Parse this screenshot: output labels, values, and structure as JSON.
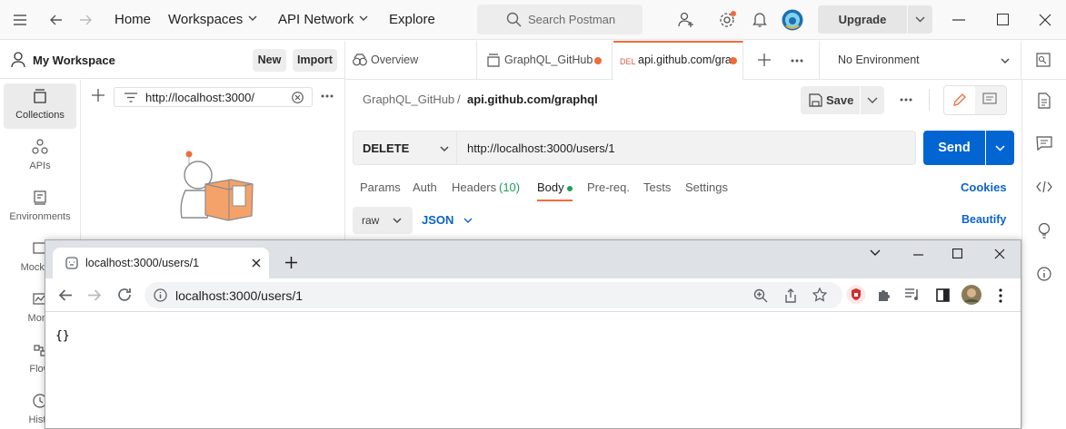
{
  "topbar": {
    "nav": [
      "Home",
      "Workspaces",
      "API Network",
      "Explore"
    ],
    "search_placeholder": "Search Postman",
    "upgrade_label": "Upgrade"
  },
  "sidebar": {
    "workspace_title": "My Workspace",
    "new_label": "New",
    "import_label": "Import",
    "filter_value": "http://localhost:3000/",
    "rail_items": [
      "Collections",
      "APIs",
      "Environments",
      "Mock Se",
      "Monit",
      "Flow",
      "Histo"
    ]
  },
  "tabs": {
    "overview": "Overview",
    "graphql": "GraphQL_GitHub",
    "del_method": "DEL",
    "del_url": "api.github.com/gra",
    "environment": "No Environment"
  },
  "request": {
    "breadcrumb_collection": "GraphQL_GitHub",
    "breadcrumb_sep": "/",
    "breadcrumb_request": "api.github.com/graphql",
    "save_label": "Save",
    "method": "DELETE",
    "url": "http://localhost:3000/users/1",
    "send_label": "Send",
    "tabs": {
      "params": "Params",
      "auth": "Auth",
      "headers": "Headers",
      "headers_count": "(10)",
      "body": "Body",
      "prereq": "Pre-req.",
      "tests": "Tests",
      "settings": "Settings"
    },
    "cookies_label": "Cookies",
    "body_mode": "raw",
    "body_format": "JSON",
    "beautify_label": "Beautify"
  },
  "browser": {
    "tab_title": "localhost:3000/users/1",
    "address": "localhost:3000/users/1",
    "content": "{}"
  },
  "colors": {
    "accent_orange": "#f26b3a",
    "send_blue": "#0265d2",
    "link_blue": "#0b64cb"
  }
}
